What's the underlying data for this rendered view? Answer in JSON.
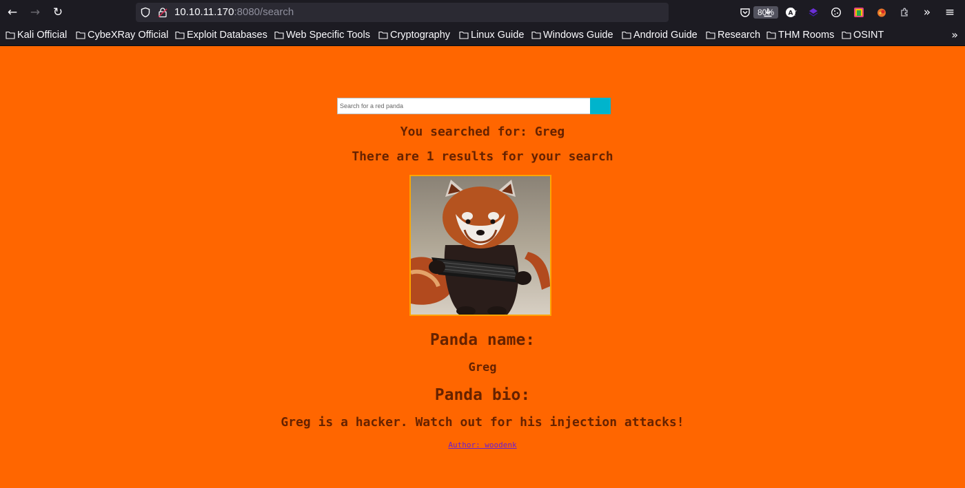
{
  "browser": {
    "url_host": "10.10.11.170",
    "url_rest": ":8080/search",
    "zoom": "80%"
  },
  "bookmarks": [
    {
      "label": "Kali Official"
    },
    {
      "label": "CybeXRay Official"
    },
    {
      "label": "Exploit Databases"
    },
    {
      "label": "Web Specific Tools"
    },
    {
      "label": "Cryptography"
    },
    {
      "label": "Linux Guide"
    },
    {
      "label": "Windows Guide"
    },
    {
      "label": "Android Guide"
    },
    {
      "label": "Research"
    },
    {
      "label": "THM Rooms"
    },
    {
      "label": "OSINT"
    }
  ],
  "search": {
    "placeholder": "Search for a red panda",
    "value": ""
  },
  "result": {
    "searched_text": "You searched for: Greg",
    "count_text": "There are 1 results for your search",
    "name_heading": "Panda name:",
    "name": "Greg",
    "bio_heading": "Panda bio:",
    "bio": "Greg is a hacker. Watch out for his injection attacks!",
    "author_link": "Author: woodenk"
  },
  "colors": {
    "page_background": "#ff6600",
    "text": "#662200",
    "search_button": "#00b4cc",
    "image_border": "#ffa500",
    "link": "#6a1fd1"
  }
}
